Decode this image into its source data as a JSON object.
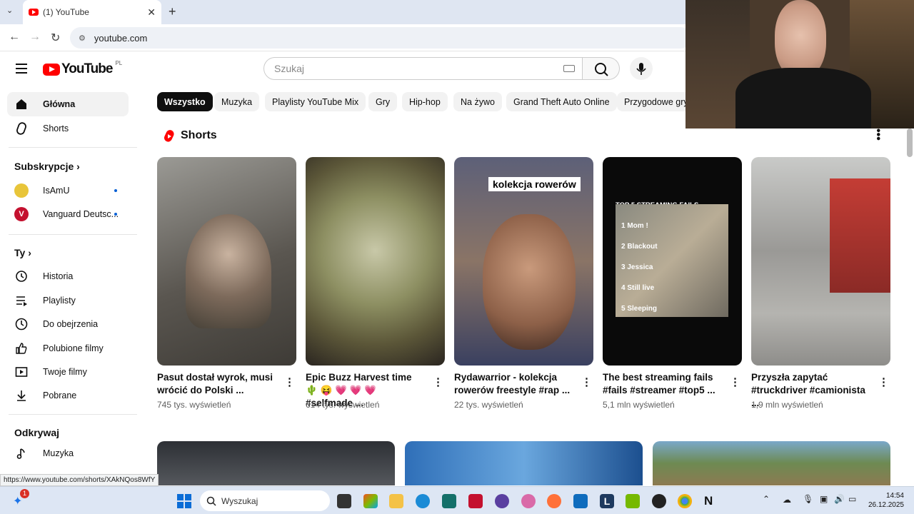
{
  "browser": {
    "tab_title": "(1) YouTube",
    "url": "youtube.com",
    "status_url": "https://www.youtube.com/shorts/XAkNQos8WfY"
  },
  "header": {
    "logo_text": "YouTube",
    "country_code": "PL",
    "search_placeholder": "Szukaj"
  },
  "sidebar": {
    "main": [
      {
        "label": "Główna",
        "icon": "home-icon"
      },
      {
        "label": "Shorts",
        "icon": "shorts-icon"
      }
    ],
    "subscriptions_heading": "Subskrypcje",
    "subscriptions": [
      {
        "label": "IsAmU",
        "avatar_color": "#e8c53a"
      },
      {
        "label": "Vanguard Deutsc...",
        "avatar_color": "#c4112f"
      }
    ],
    "you_heading": "Ty",
    "you": [
      {
        "label": "Historia",
        "icon": "history-icon"
      },
      {
        "label": "Playlisty",
        "icon": "playlist-icon"
      },
      {
        "label": "Do obejrzenia",
        "icon": "clock-icon"
      },
      {
        "label": "Polubione filmy",
        "icon": "thumb-up-icon"
      },
      {
        "label": "Twoje filmy",
        "icon": "video-icon"
      },
      {
        "label": "Pobrane",
        "icon": "download-icon"
      }
    ],
    "explore_heading": "Odkrywaj",
    "explore": [
      {
        "label": "Muzyka",
        "icon": "music-icon"
      }
    ]
  },
  "chips": [
    "Wszystko",
    "Muzyka",
    "Playlisty YouTube Mix",
    "Gry",
    "Hip-hop",
    "Na żywo",
    "Grand Theft Auto Online",
    "Przygodowe gry"
  ],
  "shorts": {
    "heading": "Shorts",
    "items": [
      {
        "title": "Pasut dostał wyrok, musi wrócić do Polski ...",
        "views": "745 tys. wyświetleń",
        "overlay": "",
        "bg": "#6b6a66"
      },
      {
        "title": "Epic Buzz Harvest time 🌵 😝 💗 💗 💗 #selfmade ...",
        "views": "614 tys. wyświetleń",
        "overlay": "",
        "bg": "#8a8a6a"
      },
      {
        "title": "Rydawarrior - kolekcja rowerów freestyle #rap ...",
        "views": "22 tys. wyświetleń",
        "overlay": "kolekcja rowerów",
        "bg": "#7a6a60"
      },
      {
        "title": "The best streaming fails #fails #streamer #top5 ...",
        "views": "5,1 mln wyświetleń",
        "overlay": "TOP 5 STREAMING FAILS",
        "bg": "#0a0a0a"
      },
      {
        "title": "Przyszła zapytać #truckdriver #camionista ...",
        "views": "1,9 mln wyświetleń",
        "overlay": "",
        "bg": "#8d8c88"
      }
    ],
    "fails_list": [
      "1 Mom !",
      "2 Blackout",
      "3 Jessica",
      "4 Still live",
      "5 Sleeping"
    ]
  },
  "taskbar": {
    "search_label": "Wyszukaj",
    "time": "14:54",
    "date": "26.12.2025",
    "badge": "1"
  }
}
